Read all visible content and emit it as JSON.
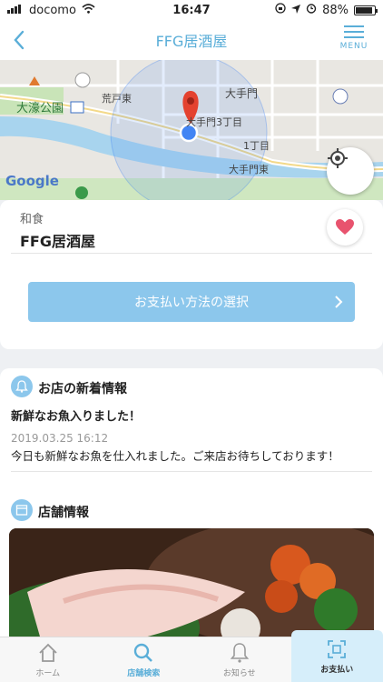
{
  "status": {
    "carrier": "docomo",
    "time": "16:47",
    "battery": "88%",
    "battery_level": 0.88
  },
  "header": {
    "title": "FFG居酒屋",
    "menu_label": "MENU"
  },
  "map": {
    "labels": {
      "park": "大濠公園",
      "arato": "荒戸東",
      "otemon": "大手門",
      "otemon3": "大手門3丁目",
      "chome1": "1丁目",
      "otemonhigashi": "大手門東"
    },
    "google": "Google"
  },
  "store": {
    "category": "和食",
    "name": "FFG居酒屋",
    "pay_button": "お支払い方法の選択"
  },
  "news": {
    "section_title": "お店の新着情報",
    "headline": "新鮮なお魚入りました！",
    "date": "2019.03.25 16:12",
    "body": "今日も新鮮なお魚を仕入れました。ご来店お待ちしております！"
  },
  "info": {
    "section_title": "店舗情報"
  },
  "tabs": {
    "home": "ホーム",
    "search": "店舗検索",
    "notice": "お知らせ",
    "pay": "お支払い"
  },
  "colors": {
    "accent": "#5aaed8",
    "button": "#8cc7ec",
    "heart": "#e8536e"
  }
}
